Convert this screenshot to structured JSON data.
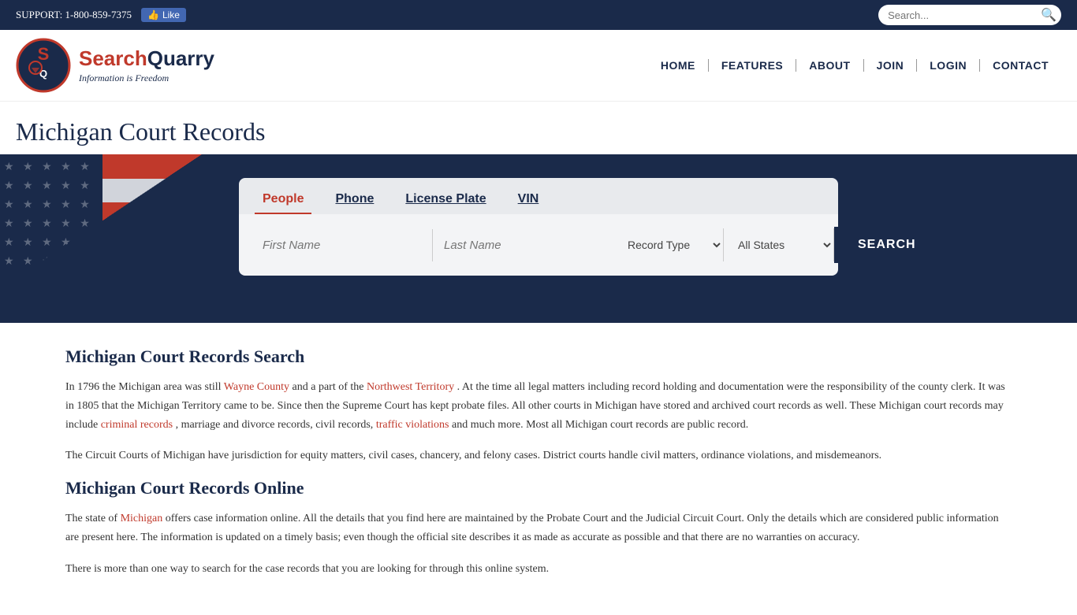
{
  "topbar": {
    "support_label": "SUPPORT:",
    "phone": "1-800-859-7375",
    "fb_like": "Like"
  },
  "search_placeholder": "Search...",
  "nav": {
    "items": [
      {
        "label": "HOME",
        "href": "#"
      },
      {
        "label": "FEATURES",
        "href": "#"
      },
      {
        "label": "ABOUT",
        "href": "#"
      },
      {
        "label": "JOIN",
        "href": "#"
      },
      {
        "label": "LOGIN",
        "href": "#"
      },
      {
        "label": "CONTACT",
        "href": "#"
      }
    ]
  },
  "page_title": "Michigan Court Records",
  "logo": {
    "brand_name": "SearchQuarry",
    "tagline": "Information is Freedom"
  },
  "search": {
    "tabs": [
      {
        "label": "People",
        "active": true
      },
      {
        "label": "Phone",
        "active": false
      },
      {
        "label": "License Plate",
        "active": false
      },
      {
        "label": "VIN",
        "active": false
      }
    ],
    "first_name_placeholder": "First Name",
    "last_name_placeholder": "Last Name",
    "record_type_label": "Record Type",
    "all_states_label": "All States",
    "search_button": "SEARCH"
  },
  "content": {
    "section1_title": "Michigan Court Records Search",
    "section1_p1_part1": "In 1796 the Michigan area was still ",
    "section1_p1_wayne": "Wayne County",
    "section1_p1_part2": " and a part of the ",
    "section1_p1_northwest": "Northwest Territory",
    "section1_p1_part3": ". At the time all legal matters including record holding and documentation were the responsibility of the county clerk. It was in 1805 that the Michigan Territory came to be. Since then the Supreme Court has kept probate files. All other courts in Michigan have stored and archived court records as well. These Michigan court records may include ",
    "section1_p1_criminal": "criminal records",
    "section1_p1_part4": ", marriage and divorce records, civil records, ",
    "section1_p1_traffic": "traffic violations",
    "section1_p1_part5": " and much more. Most all Michigan court records are public record.",
    "section1_p2": "The Circuit Courts of Michigan have jurisdiction for equity matters, civil cases, chancery, and felony cases. District courts handle civil matters, ordinance violations, and misdemeanors.",
    "section2_title": "Michigan Court Records Online",
    "section2_p1_part1": "The state of ",
    "section2_p1_michigan": "Michigan",
    "section2_p1_part2": " offers case information online. All the details that you find here are maintained by the Probate Court and the Judicial Circuit Court. Only the details which are considered public information are present here. The information is updated on a timely basis; even though the official site describes it as made as accurate as possible and that there are no warranties on accuracy.",
    "section2_p2": "There is more than one way to search for the case records that you are looking for through this online system."
  }
}
